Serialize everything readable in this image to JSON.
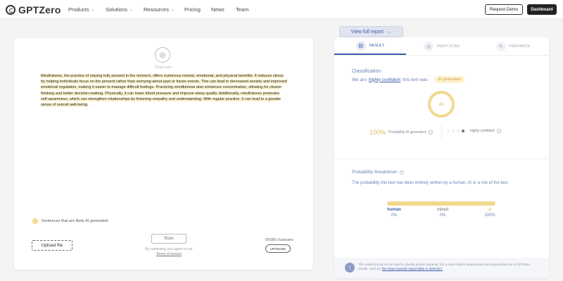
{
  "header": {
    "logo_text": "GPTZero",
    "nav": [
      {
        "label": "Products",
        "dropdown": true
      },
      {
        "label": "Solutions",
        "dropdown": true
      },
      {
        "label": "Resources",
        "dropdown": true
      },
      {
        "label": "Pricing",
        "dropdown": false
      },
      {
        "label": "News",
        "dropdown": false
      },
      {
        "label": "Team",
        "dropdown": false
      }
    ],
    "request_demo": "Request Demo",
    "dashboard": "Dashboard"
  },
  "editor": {
    "deep_scan_label": "Deep scan",
    "paragraph": "Mindfulness, the practice of staying fully present in the moment, offers numerous mental, emotional, and physical benefits. It reduces stress by helping individuals focus on the present rather than worrying about past or future events. This can lead to decreased anxiety and improved emotional regulation, making it easier to manage difficult feelings. Practicing mindfulness also enhances concentration, allowing for clearer thinking and better decision-making. Physically, it can lower blood pressure and improve sleep quality. Additionally, mindfulness promotes self-awareness, which can strengthen relationships by fostering empathy and understanding. With regular practice, it can lead to a greater sense of overall well-being.",
    "legend": "Sentences that are likely AI generated.",
    "scan_button": "Scan",
    "agree_text": "By continuing you agree to our",
    "terms_link": "Terms of service",
    "upload_button": "Upload file",
    "char_count": "0/5000 characters",
    "upgrade_button": "UPGRADE"
  },
  "report": {
    "view_full_report": "View full report",
    "tabs": [
      {
        "label": "RESULT",
        "icon": "document-icon",
        "active": true
      },
      {
        "label": "DEEP SCAN",
        "icon": "fingerprint-icon",
        "active": false
      },
      {
        "label": "FEEDBACK",
        "icon": "pencil-icon",
        "active": false
      }
    ],
    "classification_title": "Classification",
    "classification_prefix": "We are",
    "confidence_link": "highly confident",
    "classification_suffix": "this text was",
    "ai_pill": "AI generated",
    "ring_label": "AI",
    "probability": "100%",
    "probability_label": "Probability AI generated",
    "confidence_level": 4,
    "confidence_label": "highly confident",
    "breakdown_title": "Probability Breakdown",
    "breakdown_desc": "The probability this text has been entirely written by a human, AI or a mix of the two.",
    "breakdown": [
      {
        "name": "human",
        "value": "0%",
        "color": "#3b5ba9"
      },
      {
        "name": "mixed",
        "value": "0%",
        "color": "#666666"
      },
      {
        "name": "ai",
        "value": "100%",
        "color": "#e3bb5c"
      }
    ],
    "footer_text": "This result should not be used to directly punish students. For a more holistic assessment and responsible use of GPTZero results, read our",
    "footer_link": "five steps towards responsible AI detection."
  }
}
